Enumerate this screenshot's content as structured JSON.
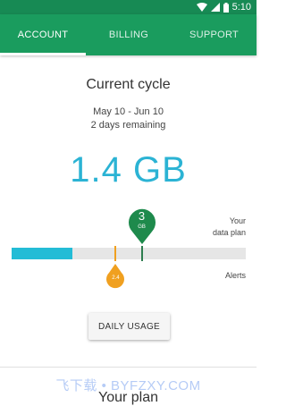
{
  "status_bar": {
    "time": "5:10"
  },
  "tabs": [
    {
      "label": "ACCOUNT",
      "active": true
    },
    {
      "label": "BILLING",
      "active": false
    },
    {
      "label": "SUPPORT",
      "active": false
    }
  ],
  "cycle": {
    "title": "Current cycle",
    "dates": "May 10 - Jun 10",
    "remaining": "2 days remaining"
  },
  "usage": {
    "value": "1.4 GB",
    "used_gb": 1.4,
    "alert_gb": 2.4,
    "plan_gb": 3,
    "scale_max_gb": 5.4,
    "plan_pin_value": "3",
    "plan_pin_unit": "GB",
    "alert_pin_value": "2.4",
    "plan_label_line1": "Your",
    "plan_label_line2": "data plan",
    "alerts_label": "Alerts"
  },
  "daily_usage_button": "DAILY USAGE",
  "watermark": "飞下载 • BYFZXY.COM",
  "plan_section_title": "Your plan",
  "colors": {
    "tab_bar": "#1a9c5e",
    "status_bar": "#178a54",
    "usage_fill": "#23bcd6",
    "usage_text": "#2bb3d4",
    "plan_marker": "#1e8a4c",
    "alert_marker": "#f0a020"
  }
}
